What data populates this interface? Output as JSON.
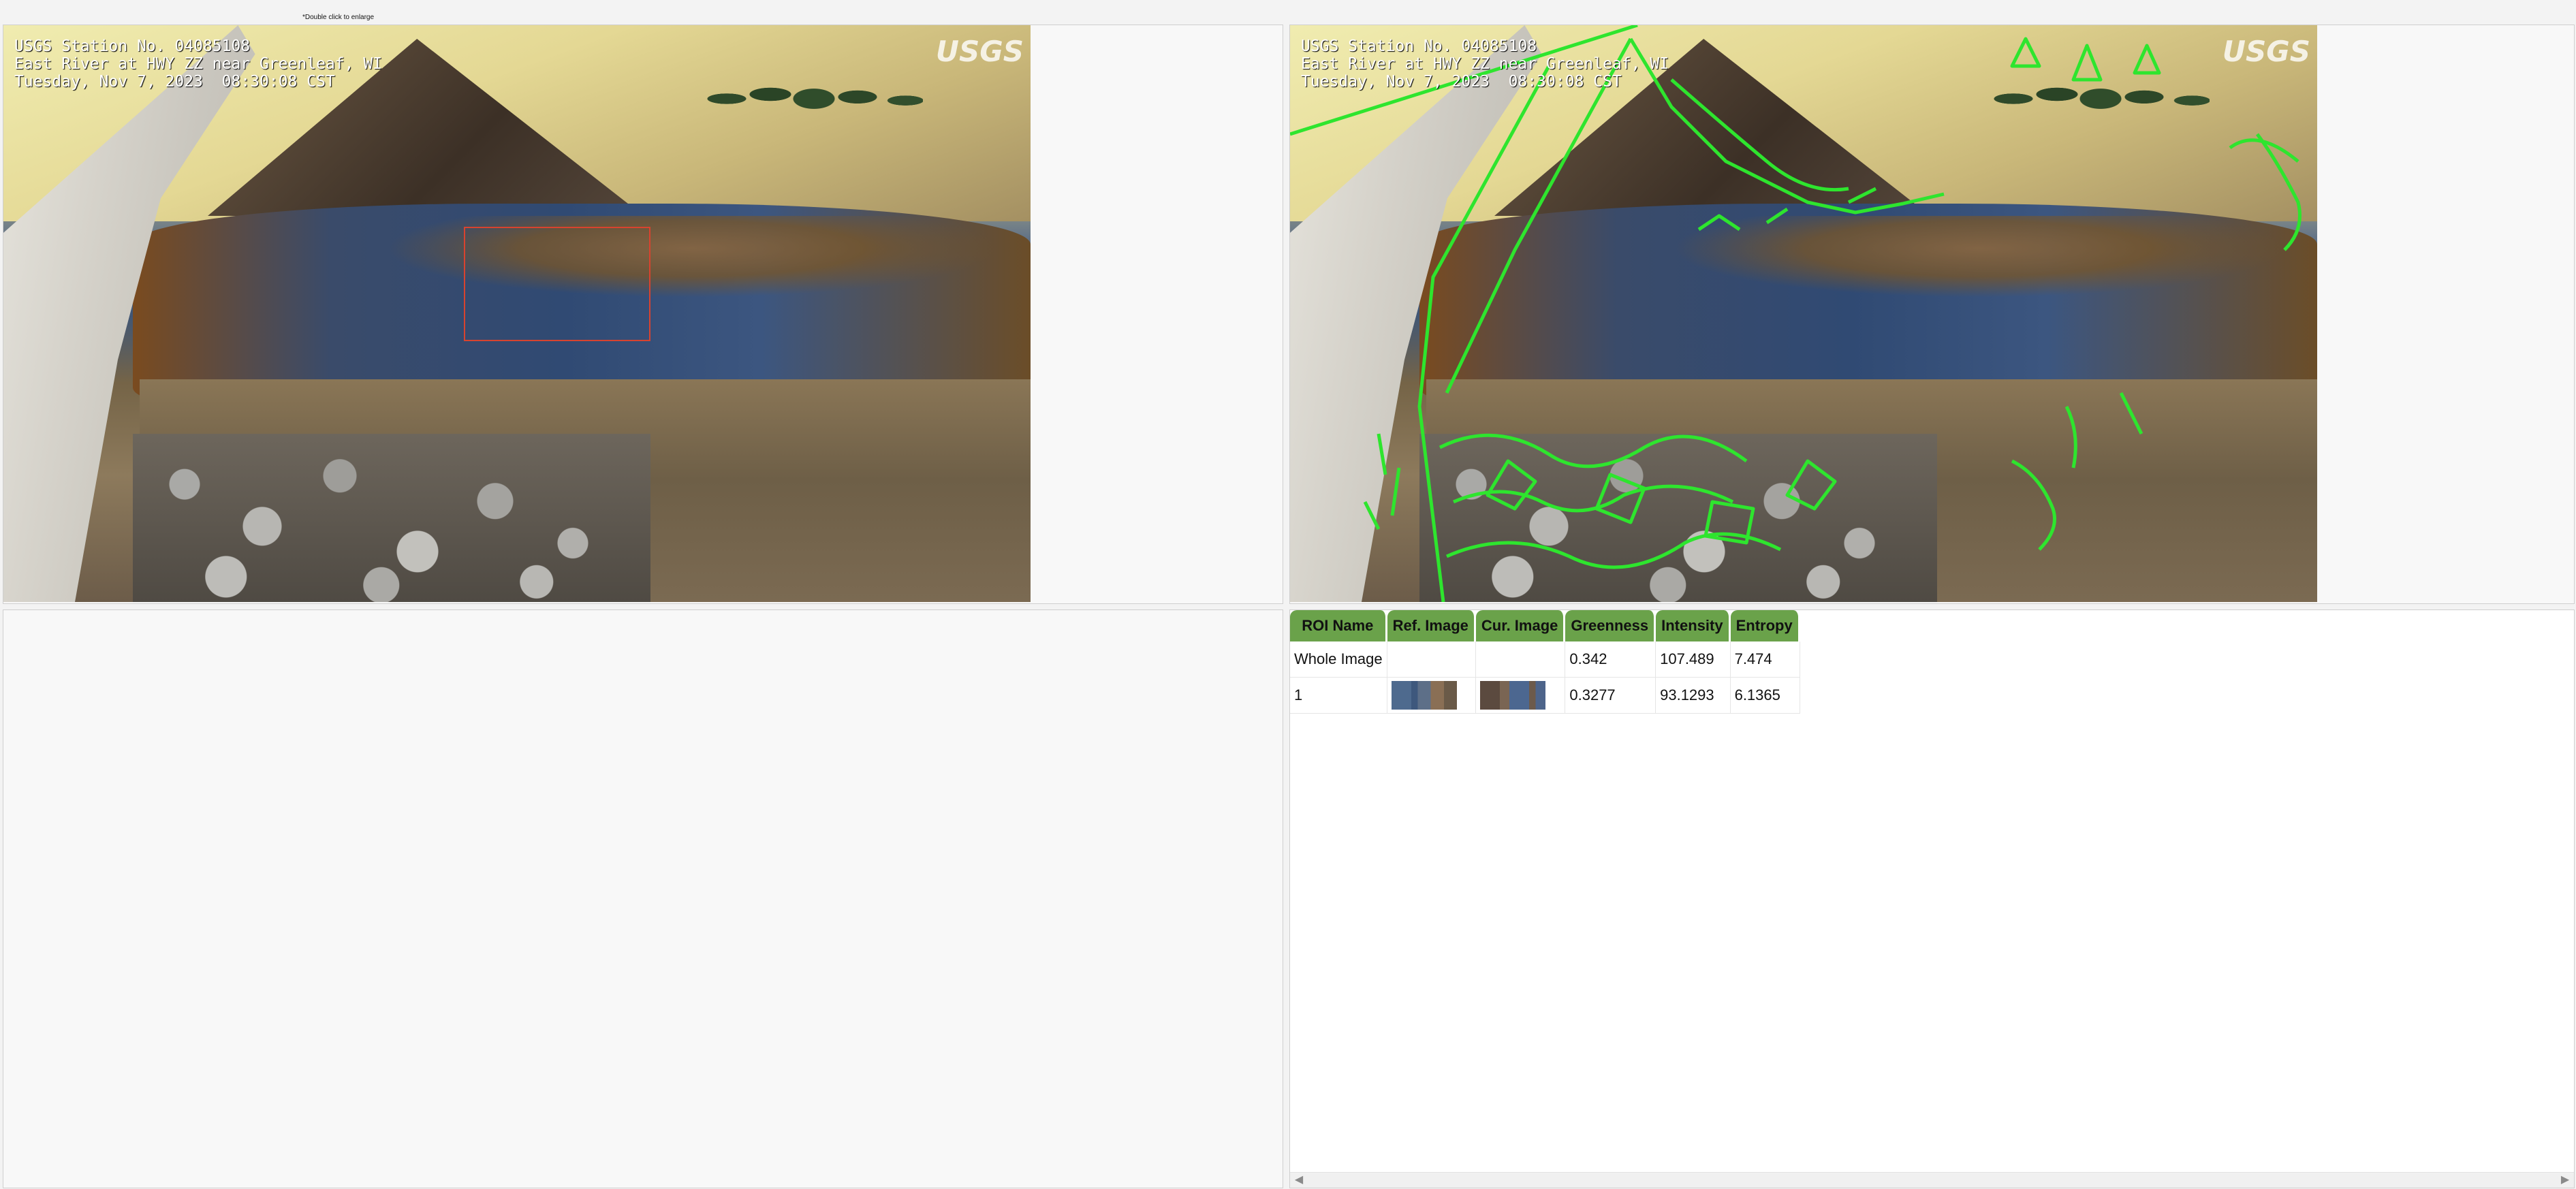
{
  "hint": {
    "text": "*Double click to enlarge"
  },
  "camera": {
    "station_line": "USGS Station No. 04085108",
    "site_line": "East River at HWY ZZ near Greenleaf, WI",
    "datetime_line": "Tuesday, Nov 7, 2023  08:30:08 CST",
    "logo_text": "USGS"
  },
  "roi_table": {
    "columns": [
      "ROI Name",
      "Ref. Image",
      "Cur. Image",
      "Greenness",
      "Intensity",
      "Entropy"
    ],
    "rows": [
      {
        "name": "Whole Image",
        "greenness": "0.342",
        "intensity": "107.489",
        "entropy": "7.474"
      },
      {
        "name": "1",
        "greenness": "0.3277",
        "intensity": "93.1293",
        "entropy": "6.1365"
      }
    ]
  },
  "colors": {
    "table_header": "#6aa24a",
    "roi_box": "#d8432f",
    "edge_overlay": "#2ee52e"
  },
  "icons": {
    "scroll_left": "triangle-left-icon",
    "scroll_right": "triangle-right-icon"
  }
}
